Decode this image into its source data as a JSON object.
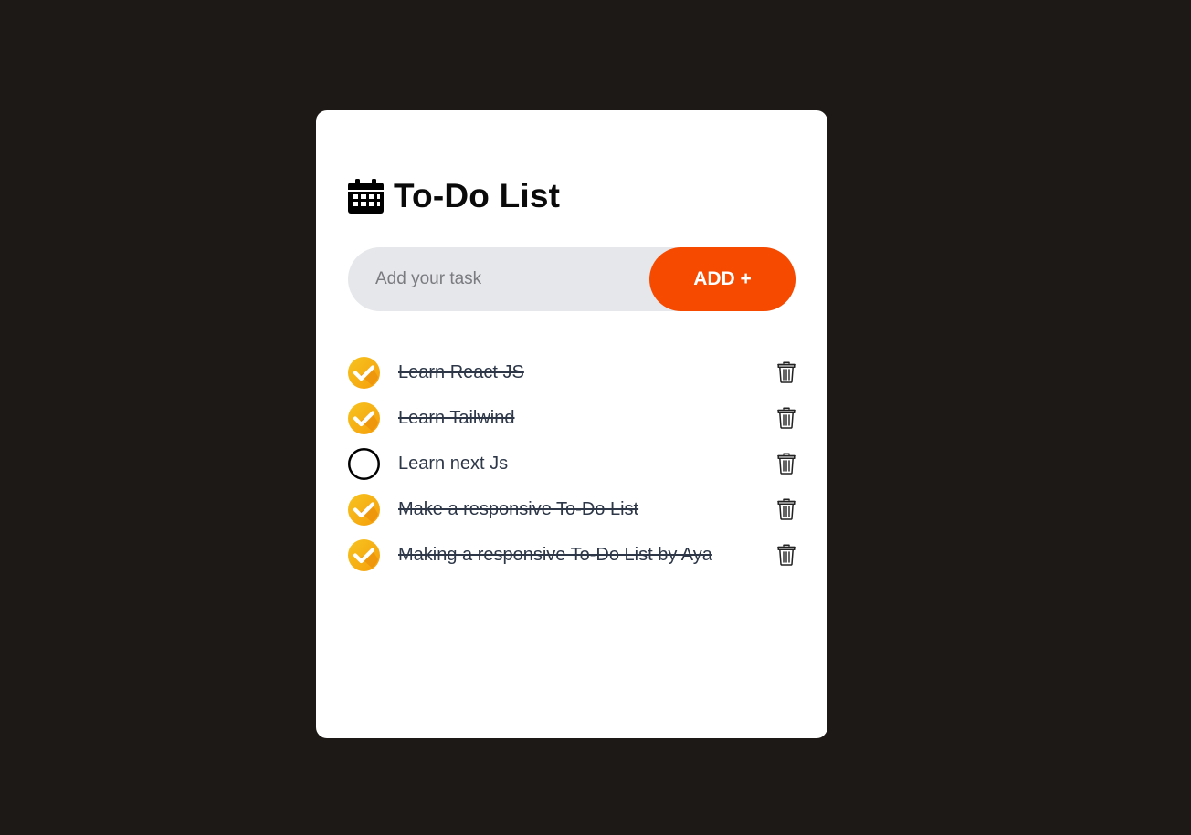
{
  "header": {
    "title": "To-Do List",
    "icon": "calendar-icon"
  },
  "input": {
    "placeholder": "Add your task",
    "value": ""
  },
  "add_button": {
    "label": "ADD +"
  },
  "tasks": [
    {
      "text": "Learn React JS",
      "done": true
    },
    {
      "text": "Learn Tailwind",
      "done": true
    },
    {
      "text": "Learn next Js",
      "done": false
    },
    {
      "text": "Make a responsive To-Do List",
      "done": true
    },
    {
      "text": "Making a responsive To-Do List by Aya",
      "done": true
    }
  ],
  "colors": {
    "page_background": "#1d1916",
    "card_background": "#ffffff",
    "accent": "#f54a00",
    "input_background": "#e6e7ea",
    "check_gradient_start": "#f7c41f",
    "check_gradient_end": "#f59e0b",
    "task_text": "#2d3748"
  },
  "icons": {
    "done": "check-circle-icon",
    "not_done": "empty-circle-icon",
    "delete": "trash-icon"
  }
}
